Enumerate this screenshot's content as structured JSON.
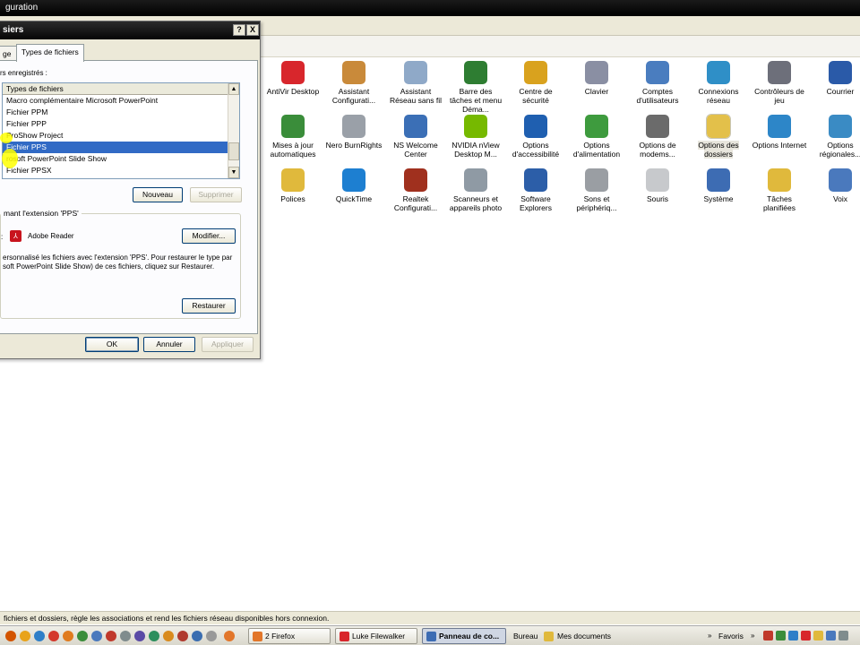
{
  "window": {
    "title": "guration"
  },
  "dialog": {
    "title": "siers",
    "help_btn": "?",
    "close_btn": "X",
    "tabs": [
      "ge",
      "Types de fichiers"
    ],
    "list_caption": "rs enregistrés :",
    "list_header": "Types de fichiers",
    "list_items": [
      "Macro complémentaire Microsoft PowerPoint",
      "Fichier PPM",
      "Fichier PPP",
      "ProShow Project",
      "Fichier PPS",
      "rosoft PowerPoint Slide Show",
      "Fichier PPSX"
    ],
    "selected_index": 4,
    "new_btn": "Nouveau",
    "delete_btn": "Supprimer",
    "group_title": "mant l'extension 'PPS'",
    "opens_with": "Adobe Reader",
    "modify_btn": "Modifier...",
    "info_line1": "ersonnalisé les fichiers avec l'extension 'PPS'. Pour restaurer le type par",
    "info_line2": "soft PowerPoint Slide Show) de ces fichiers, cliquez sur Restaurer.",
    "restore_btn": "Restaurer",
    "ok_btn": "OK",
    "cancel_btn": "Annuler",
    "apply_btn": "Appliquer"
  },
  "control_panel": {
    "row1": [
      {
        "label": "AntiVir Desktop",
        "icon": "antivir-icon",
        "color": "#d8262c"
      },
      {
        "label": "Assistant Configurati...",
        "icon": "home-config-icon",
        "color": "#c98a3a"
      },
      {
        "label": "Assistant Réseau sans fil",
        "icon": "wireless-icon",
        "color": "#8fa9c8"
      },
      {
        "label": "Barre des tâches et menu Déma...",
        "icon": "taskbar-icon",
        "color": "#2e7d32"
      },
      {
        "label": "Centre de sécurité",
        "icon": "shield-icon",
        "color": "#d9a21e"
      },
      {
        "label": "Clavier",
        "icon": "keyboard-icon",
        "color": "#8a8fa3"
      },
      {
        "label": "Comptes d'utilisateurs",
        "icon": "users-icon",
        "color": "#4a7dbf"
      },
      {
        "label": "Connexions réseau",
        "icon": "network-globe-icon",
        "color": "#2f8fc7"
      },
      {
        "label": "Contrôleurs de jeu",
        "icon": "gamepad-icon",
        "color": "#6d6f7a"
      },
      {
        "label": "Courrier",
        "icon": "mail-icon",
        "color": "#2a5aa8"
      }
    ],
    "row2": [
      {
        "label": "Mises à jour automatiques",
        "icon": "windows-update-icon",
        "color": "#3a8d3a"
      },
      {
        "label": "Nero BurnRights",
        "icon": "cd-icon",
        "color": "#9aa0a8"
      },
      {
        "label": "NS Welcome Center",
        "icon": "welcome-center-icon",
        "color": "#3b6fb6"
      },
      {
        "label": "NVIDIA nView Desktop M...",
        "icon": "nvidia-icon",
        "color": "#76b900"
      },
      {
        "label": "Options d'accessibilité",
        "icon": "accessibility-icon",
        "color": "#1f5fb0"
      },
      {
        "label": "Options d'alimentation",
        "icon": "power-icon",
        "color": "#3e9b3e"
      },
      {
        "label": "Options de modems...",
        "icon": "modem-icon",
        "color": "#6b6b6b"
      },
      {
        "label": "Options des dossiers",
        "icon": "folder-options-icon",
        "color": "#e3c04a"
      },
      {
        "label": "Options Internet",
        "icon": "internet-options-icon",
        "color": "#2d86c8"
      },
      {
        "label": "Options régionales...",
        "icon": "regional-icon",
        "color": "#3a8bc4"
      }
    ],
    "row3": [
      {
        "label": "Polices",
        "icon": "fonts-folder-icon",
        "color": "#e0b93c"
      },
      {
        "label": "QuickTime",
        "icon": "quicktime-icon",
        "color": "#1d7fd1"
      },
      {
        "label": "Realtek Configurati...",
        "icon": "speaker-icon",
        "color": "#a0301e"
      },
      {
        "label": "Scanneurs et appareils photo",
        "icon": "scanner-icon",
        "color": "#8f9aa4"
      },
      {
        "label": "Software Explorers",
        "icon": "software-explorer-icon",
        "color": "#2c5ea8"
      },
      {
        "label": "Sons et périphériq...",
        "icon": "sounds-icon",
        "color": "#9a9ea3"
      },
      {
        "label": "Souris",
        "icon": "mouse-icon",
        "color": "#c7c9cc"
      },
      {
        "label": "Système",
        "icon": "system-icon",
        "color": "#3d6cb3"
      },
      {
        "label": "Tâches planifiées",
        "icon": "scheduled-tasks-icon",
        "color": "#e0b93c"
      },
      {
        "label": "Voix",
        "icon": "voice-icon",
        "color": "#4a79bd"
      }
    ]
  },
  "status_text": "fichiers et dossiers, règle les associations et rend les fichiers réseau disponibles hors connexion.",
  "taskbar": {
    "tasks": [
      "2 Firefox",
      "Luke Filewalker",
      "Panneau de co..."
    ],
    "bureau": "Bureau",
    "mes_documents": "Mes documents",
    "favoris": "Favoris"
  }
}
